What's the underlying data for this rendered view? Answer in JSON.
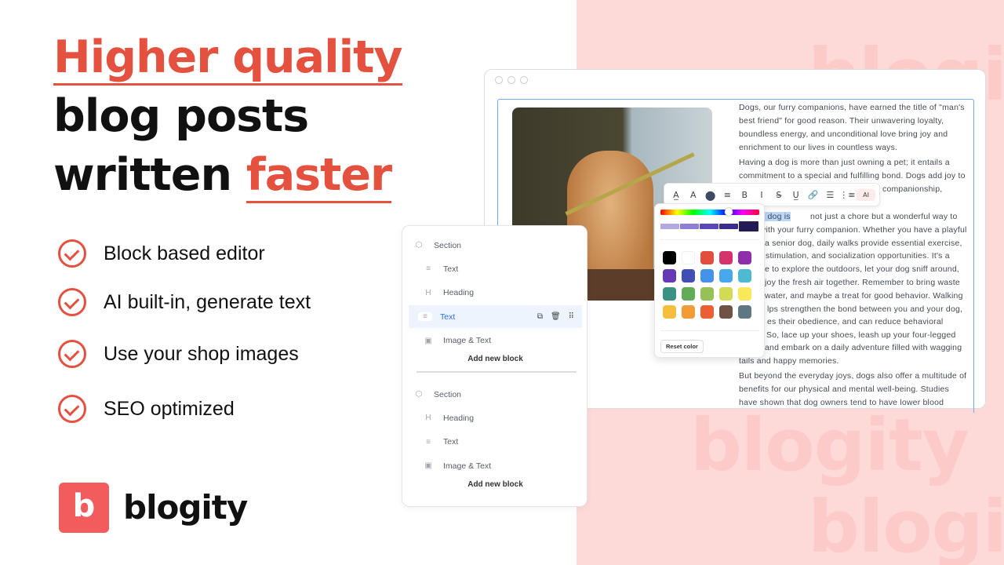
{
  "headline": {
    "line1": "Higher quality",
    "line2": "blog posts",
    "line3a": "written",
    "line3b": "faster"
  },
  "features": [
    "Block based editor",
    "AI built-in, generate text",
    "Use your shop images",
    "SEO optimized"
  ],
  "brand": {
    "logo_letter": "b",
    "name": "blogity",
    "watermark": "blogity",
    "color": "#f25c5c",
    "accent": "#e4513f"
  },
  "editor": {
    "lines": [
      "Dogs, our furry companions, have earned the title of \"man's",
      "best friend\" for good reason. Their unwavering loyalty,",
      "boundless energy, and unconditional love bring joy and",
      "enrichment to our lives in countless ways.",
      "Having a dog is more than just owning a pet; it entails a",
      "commitment to a special and fulfilling bond. Dogs add joy to",
      "companionship,",
      " not just a chore but a wonderful way to",
      "vith your furry companion. Whether you have a playful",
      "a senior dog, daily walks provide essential exercise,",
      "stimulation, and socialization opportunities. It's a",
      "e to explore the outdoors, let your dog sniff around,",
      "joy the fresh air together. Remember to bring waste",
      "water, and maybe a treat for good behavior. Walking",
      "lps strengthen the bond between you and your dog,",
      "es their obedience, and can reduce behavioral",
      "So, lace up your shoes, leash up your four-legged",
      "and embark on a daily adventure filled with wagging",
      "tails and happy memories.",
      "But beyond the everyday joys, dogs also offer a multitude of",
      "benefits for our physical and mental well-being. Studies",
      "have shown that dog owners tend to have lower blood"
    ],
    "selected_text": "g your dog is",
    "toolbar": {
      "icons": [
        "text-color-icon",
        "highlight-icon",
        "color-circle-icon",
        "align-icon",
        "bold-icon",
        "italic-icon",
        "strikethrough-icon",
        "underline-icon",
        "link-icon",
        "bullet-list-icon",
        "numbered-list-icon"
      ],
      "glyphs": [
        "A̲",
        "A",
        "●",
        "≡",
        "B",
        "I",
        "S̶",
        "U̲",
        "🔗",
        "☰",
        "⋮≡"
      ],
      "ai_label": "AI"
    },
    "color_picker": {
      "shades": [
        "#b3a8e0",
        "#8d7fd3",
        "#5a46b8",
        "#3a2c8c",
        "#241a55"
      ],
      "swatches": [
        "#000000",
        "#ffffff",
        "#e24d3d",
        "#d6336c",
        "#8e2eab",
        "#6639b5",
        "#3f4fb3",
        "#4592ea",
        "#48a8ee",
        "#4ebad1",
        "#3b9184",
        "#63ac57",
        "#96c156",
        "#d3db55",
        "#f9e857",
        "#f5be3c",
        "#f29c36",
        "#ec5f34",
        "#6f5243",
        "#5f7685"
      ],
      "reset_label": "Reset color"
    }
  },
  "blocks": {
    "sections": [
      {
        "label": "Section",
        "items": [
          {
            "icon": "text-icon",
            "label": "Text"
          },
          {
            "icon": "heading-icon",
            "label": "Heading"
          },
          {
            "icon": "text-icon",
            "label": "Text",
            "selected": true
          },
          {
            "icon": "image-icon",
            "label": "Image & Text"
          }
        ],
        "add_label": "Add new block"
      },
      {
        "label": "Section",
        "items": [
          {
            "icon": "heading-icon",
            "label": "Heading"
          },
          {
            "icon": "text-icon",
            "label": "Text"
          },
          {
            "icon": "image-icon",
            "label": "Image & Text"
          }
        ],
        "add_label": "Add new block"
      }
    ]
  }
}
